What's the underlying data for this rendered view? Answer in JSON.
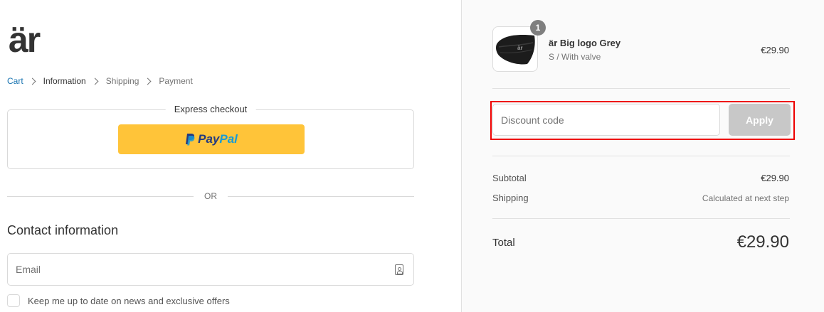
{
  "brand": {
    "logo_text": "är"
  },
  "breadcrumb": {
    "items": [
      {
        "label": "Cart",
        "state": "link"
      },
      {
        "label": "Information",
        "state": "current"
      },
      {
        "label": "Shipping",
        "state": "muted"
      },
      {
        "label": "Payment",
        "state": "muted"
      }
    ]
  },
  "express_checkout": {
    "title": "Express checkout",
    "paypal_pay": "Pay",
    "paypal_pal": "Pal",
    "button_color": "#ffc439"
  },
  "divider_text": "OR",
  "contact": {
    "title": "Contact information",
    "email_placeholder": "Email",
    "newsletter_label": "Keep me up to date on news and exclusive offers"
  },
  "order": {
    "item": {
      "name": "är Big logo Grey",
      "variant": "S / With valve",
      "price": "€29.90",
      "quantity": "1"
    },
    "discount": {
      "placeholder": "Discount code",
      "apply_label": "Apply"
    },
    "subtotal_label": "Subtotal",
    "subtotal_value": "€29.90",
    "shipping_label": "Shipping",
    "shipping_value": "Calculated at next step",
    "total_label": "Total",
    "total_value": "€29.90"
  },
  "colors": {
    "link": "#1773b0",
    "highlight": "#ee0000",
    "apply_disabled": "#c8c8c8"
  }
}
